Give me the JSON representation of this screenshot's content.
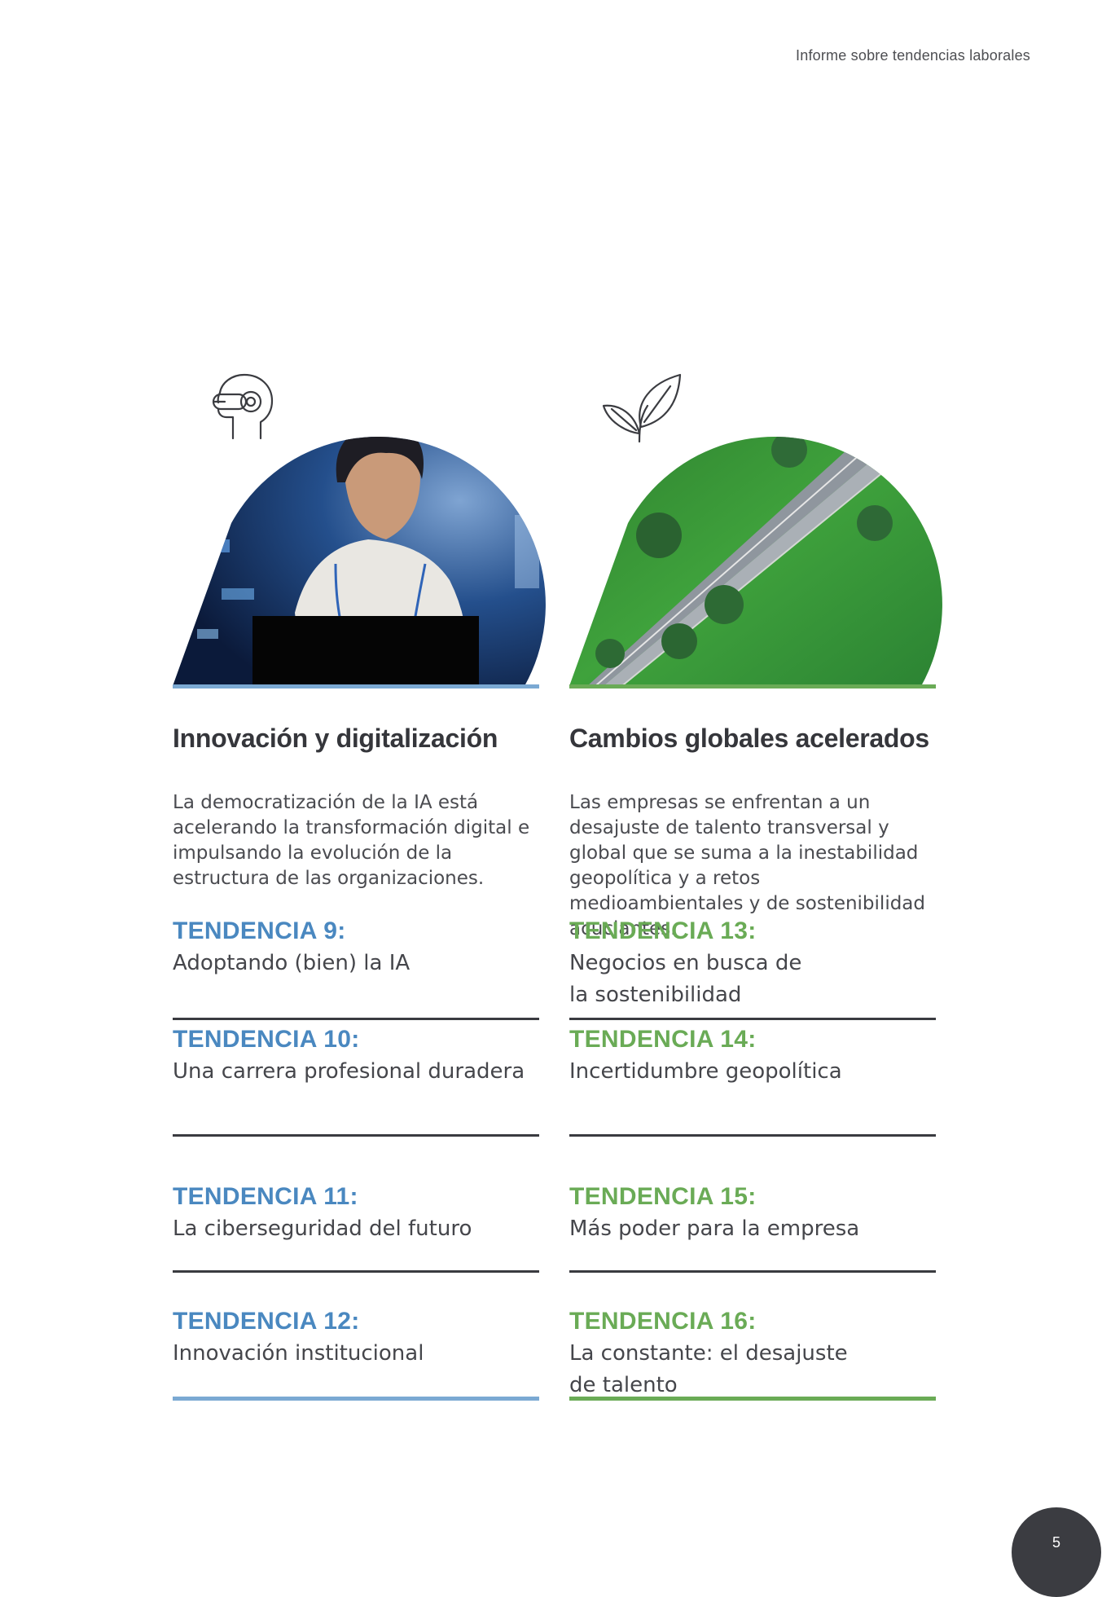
{
  "header": {
    "title": "Informe sobre tendencias laborales"
  },
  "columns": [
    {
      "title": "Innovación y digitalización",
      "description": "La democratización de la IA está acelerando la transformación digital e impulsando la evolución de la estructura de las organizaciones.",
      "icon": "vr-headset-head-icon",
      "accent_color": "#4a88c0",
      "trends": [
        {
          "label": "TENDENCIA 9:",
          "text": "Adoptando (bien) la IA"
        },
        {
          "label": "TENDENCIA 10:",
          "text": "Una carrera profesional duradera"
        },
        {
          "label": "TENDENCIA 11:",
          "text": "La ciberseguridad del futuro"
        },
        {
          "label": "TENDENCIA 12:",
          "text": "Innovación institucional"
        }
      ]
    },
    {
      "title": "Cambios globales acelerados",
      "description": "Las empresas se enfrentan a un desajuste de talento transversal y global que se suma a la inestabilidad geopolítica y a retos medioambientales y de sostenibilidad acuciantes.",
      "icon": "leaf-sprout-icon",
      "accent_color": "#6aab56",
      "trends": [
        {
          "label": "TENDENCIA 13:",
          "text": "Negocios en busca de la sostenibilidad"
        },
        {
          "label": "TENDENCIA 14:",
          "text": "Incertidumbre geopolítica"
        },
        {
          "label": "TENDENCIA 15:",
          "text": "Más poder para la empresa"
        },
        {
          "label": "TENDENCIA 16:",
          "text": "La constante: el desajuste de talento"
        }
      ]
    }
  ],
  "page": {
    "number": "5"
  }
}
